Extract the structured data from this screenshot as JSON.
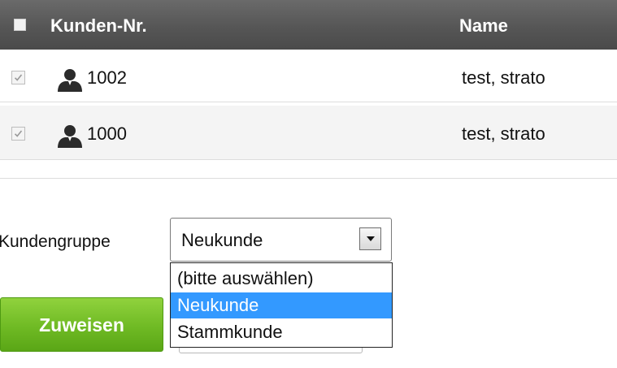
{
  "table": {
    "header": {
      "kunden_nr": "Kunden-Nr.",
      "name": "Name"
    },
    "rows": [
      {
        "checked": true,
        "kunden_nr": "1002",
        "name": "test, strato",
        "icon": "user-icon"
      },
      {
        "checked": true,
        "kunden_nr": "1000",
        "name": "test, strato",
        "icon": "user-icon"
      }
    ]
  },
  "form": {
    "group_label": "Kundengruppe",
    "select_value": "Neukunde",
    "options": [
      "(bitte auswählen)",
      "Neukunde",
      "Stammkunde"
    ],
    "selected_option": "Neukunde",
    "assign_button": "Zuweisen"
  },
  "colors": {
    "header_bg": "#565656",
    "highlight": "#3399ff",
    "button_green": "#6fba24"
  }
}
